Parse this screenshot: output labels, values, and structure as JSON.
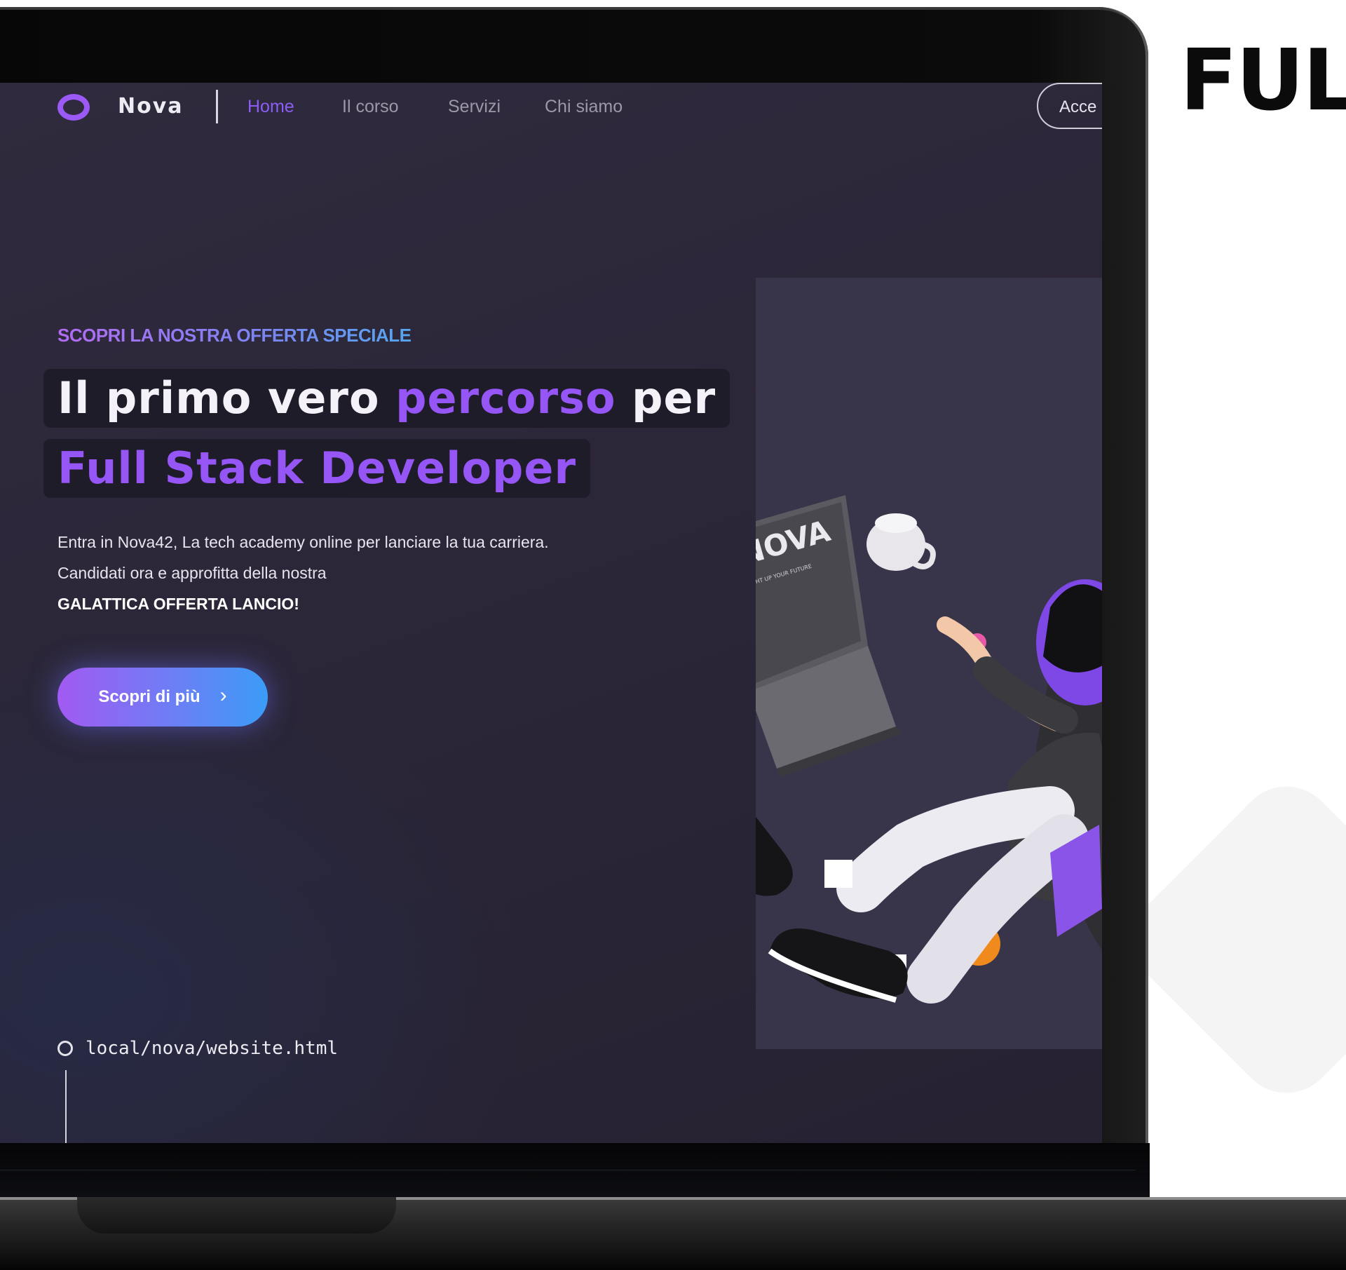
{
  "side_heading": "FUL",
  "nav": {
    "brand": "Nova",
    "links": [
      "Home",
      "Il corso",
      "Servizi",
      "Chi siamo"
    ],
    "active": "Home",
    "access_label": "Acce"
  },
  "hero": {
    "eyebrow": "SCOPRI LA NOSTRA OFFERTA SPECIALE",
    "headline_line1_a": "Il primo vero ",
    "headline_line1_accent": "percorso",
    "headline_line1_b": " per",
    "headline_line2": "Full Stack Developer",
    "body_line1": "Entra in Nova42, La tech academy online per lanciare la tua carriera.",
    "body_line2": "Candidati ora e approfitta della nostra",
    "body_line3": "GALATTICA OFFERTA LANCIO!",
    "cta_label": "Scopri di più",
    "cta_arrow": "›"
  },
  "illustration": {
    "laptop_logo": "NOVA",
    "laptop_tagline": "LIGHT UP YOUR FUTURE"
  },
  "url": "local/nova/website.html",
  "colors": {
    "accent": "#9655f5",
    "gradient_start": "#a25af2",
    "gradient_end": "#3b9cf7",
    "screen_bg": "#2b2638"
  }
}
